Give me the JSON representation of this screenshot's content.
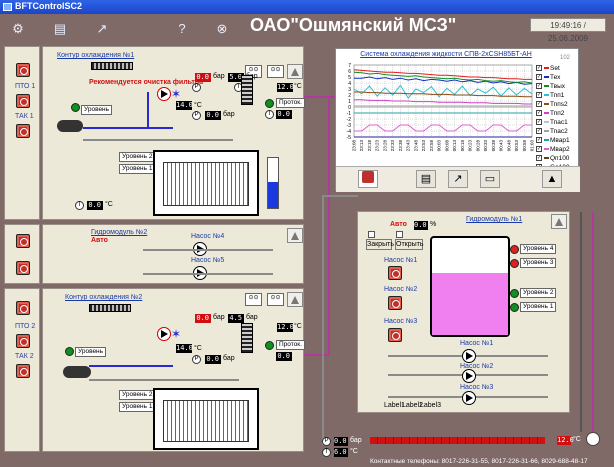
{
  "window": {
    "title": "BFTControlSC2"
  },
  "header": {
    "company": "ОАО\"Ошмянский МСЗ\"",
    "datetime": "19:49:16 / 25.06.2009"
  },
  "toolbar": {
    "icons": [
      "tool-icon",
      "panel-icon",
      "chart-icon",
      "help-icon",
      "close-icon"
    ]
  },
  "sidebar": {
    "pto1": "ПТО 1",
    "tak1": "ТАК 1",
    "pto2": "ПТО 2",
    "tak2": "ТАК 2"
  },
  "contour1": {
    "title": "Контур охлаждения №1",
    "warning": "Рекомендуется очистка фильтра",
    "p1": "0.0",
    "p2": "5.0",
    "p3": "12.0",
    "p4": "14.0",
    "p5": "0.0",
    "t1": "12.0",
    "t2": "0.0",
    "t3": "0.0",
    "unit_bar": "бар",
    "unit_c": "°C",
    "level": "Уровень",
    "level2": "Уровень 2",
    "level1": "Уровень 1",
    "flow": "Проток."
  },
  "module2": {
    "title": "Гидромодуль №2",
    "mode": "Авто",
    "pump4": "Насос №4",
    "pump5": "Насос №5"
  },
  "contour2": {
    "title": "Контур охлаждения №2",
    "p1": "0.0",
    "p2": "4.5",
    "p3": "12.0",
    "p4": "14.0",
    "p5": "0.0",
    "t1": "12.0",
    "t2": "0.0",
    "level": "Уровень",
    "level2": "Уровень 2",
    "level1": "Уровень 1",
    "flow": "Проток."
  },
  "module1": {
    "title": "Гидромодуль №1",
    "mode": "Авто",
    "valve_pct": "0.0",
    "pct": "%",
    "close": "Закрыть",
    "open": "Открыть",
    "nasos1": "Насос №1",
    "nasos2": "Насос №2",
    "nasos3": "Насос №3",
    "level4": "Уровень 4",
    "level3": "Уровень 3",
    "level2": "Уровень 2",
    "level1": "Уровень 1",
    "pump1": "Насос №1",
    "pump2": "Насос №2",
    "pump3": "Насос №3",
    "label1": "Label1",
    "label2": "Label2",
    "label3": "Label3"
  },
  "bottom": {
    "p": "0.0",
    "t": "6.0",
    "unit_bar": "бар",
    "unit_c": "°C",
    "t_right": "12.0",
    "contacts": "Контактные телефоны: 8017-226-31-55, 8017-226-31-66, 8029-688-48-17"
  },
  "chart_data": {
    "type": "line",
    "title": "Система охлаждения жидкости СПВ-2хСSH85БТ-АН",
    "corner_label": "102",
    "ylim": [
      -5,
      7
    ],
    "yticks": [
      "7",
      "6",
      "5",
      "4",
      "3",
      "2",
      "1",
      "0",
      "-1",
      "-2",
      "-3",
      "-4",
      "-5"
    ],
    "xticks": [
      "23:08",
      "23:13",
      "23:18",
      "23:23",
      "23:28",
      "23:33",
      "23:38",
      "23:43",
      "23:48",
      "23:53",
      "23:58",
      "00:03",
      "00:08",
      "00:13",
      "00:18",
      "00:23",
      "00:28",
      "00:33",
      "00:38",
      "00:43",
      "00:48",
      "00:53",
      "00:58",
      "01:03"
    ],
    "grid": true,
    "series": [
      {
        "name": "Set",
        "color": "#e02020",
        "values": [
          6.2,
          6.1,
          6.0,
          5.9,
          5.8,
          5.8,
          5.7,
          5.6,
          5.6,
          5.5,
          5.4,
          5.3,
          5.3,
          5.2,
          5.1,
          5.0,
          5.0,
          4.9,
          4.9,
          4.8,
          4.7,
          4.7,
          4.6,
          4.6
        ]
      },
      {
        "name": "Тех",
        "color": "#1030c0",
        "values": [
          4.8,
          4.8,
          5.0,
          4.7,
          4.9,
          4.6,
          4.8,
          4.5,
          4.7,
          4.4,
          4.6,
          4.5,
          4.3,
          4.5,
          4.2,
          4.4,
          4.1,
          4.3,
          4.0,
          4.2,
          3.9,
          4.1,
          3.8,
          3.9
        ]
      },
      {
        "name": "Твых",
        "color": "#109020",
        "values": [
          5.8,
          5.7,
          5.5,
          5.6,
          5.4,
          5.3,
          5.2,
          5.1,
          5.2,
          5.0,
          4.9,
          4.8,
          4.7,
          4.8,
          4.6,
          4.5,
          4.6,
          4.4,
          4.3,
          4.4,
          4.2,
          4.1,
          4.2,
          4.0
        ]
      },
      {
        "name": "Тпп1",
        "color": "#30c0d0",
        "values": [
          3.0,
          2.2,
          3.5,
          1.8,
          3.2,
          2.0,
          3.6,
          1.5,
          3.0,
          2.4,
          3.4,
          1.7,
          3.1,
          2.1,
          3.5,
          1.9,
          3.0,
          2.3,
          3.3,
          1.8,
          3.2,
          2.0,
          3.1,
          2.2
        ]
      },
      {
        "name": "Тппs2",
        "color": "#8a4a10",
        "values": [
          2.5,
          2.5,
          2.4,
          2.4,
          2.3,
          2.3,
          2.3,
          2.2,
          2.2,
          2.2,
          2.1,
          2.1,
          2.1,
          2.0,
          2.0,
          2.0,
          1.9,
          1.9,
          1.9,
          1.8,
          1.8,
          1.8,
          1.7,
          1.7
        ]
      },
      {
        "name": "Тпп2",
        "color": "#d040c0",
        "values": [
          1.2,
          1.2,
          1.1,
          1.1,
          1.1,
          1.0,
          1.0,
          1.0,
          0.9,
          0.9,
          0.9,
          0.8,
          0.8,
          0.8,
          0.8,
          0.7,
          0.7,
          0.7,
          0.6,
          0.6,
          0.6,
          0.6,
          0.5,
          0.5
        ]
      },
      {
        "name": "Тпас1",
        "color": "#c0c0c0",
        "values": [
          0.2,
          0.2,
          0.2,
          0.2,
          0.2,
          0.2,
          0.2,
          0.2,
          0.2,
          0.2,
          0.2,
          0.2,
          0.2,
          0.2,
          0.2,
          0.2,
          0.2,
          0.2,
          0.2,
          0.2,
          0.2,
          0.2,
          0.2,
          0.2
        ]
      },
      {
        "name": "Тпас2",
        "color": "#a0a0a0",
        "values": [
          0.0,
          0.0,
          0.0,
          0.0,
          0.0,
          0.0,
          0.0,
          0.0,
          0.0,
          0.0,
          0.0,
          0.0,
          0.0,
          0.0,
          0.0,
          0.0,
          0.0,
          0.0,
          0.0,
          0.0,
          0.0,
          0.0,
          0.0,
          0.0
        ]
      },
      {
        "name": "Мвар1",
        "color": "#20a0a0",
        "values": [
          -1.0,
          -1.0,
          -1.0,
          -1.0,
          -1.0,
          -1.0,
          -1.0,
          -1.0,
          -1.0,
          -1.0,
          -1.0,
          -1.0,
          -1.0,
          -1.0,
          -1.0,
          -1.0,
          -1.0,
          -1.0,
          -1.0,
          -1.0,
          -1.0,
          -1.0,
          -1.0,
          -1.0
        ]
      },
      {
        "name": "Мвар2",
        "color": "#e060d0",
        "values": [
          -4.0,
          -4.0,
          -3.0,
          -3.0,
          -4.0,
          -4.0,
          -3.0,
          -3.0,
          -4.0,
          -4.0,
          -3.0,
          -3.0,
          -4.0,
          -4.0,
          -3.0,
          -3.0,
          -4.0,
          -4.0,
          -3.0,
          -3.0,
          -4.0,
          -4.0,
          -3.0,
          -3.0
        ]
      },
      {
        "name": "Qп100",
        "color": "#604020",
        "values": [
          -5,
          -5,
          -5,
          -5,
          -5,
          -5,
          -5,
          -5,
          -5,
          -5,
          -5,
          -5,
          -5,
          -5,
          -5,
          -5,
          -5,
          -5,
          -5,
          -5,
          -5,
          -5,
          -5,
          -5
        ]
      },
      {
        "name": "Go100",
        "color": "#2020a0",
        "values": [
          -5,
          -5,
          -5,
          -5,
          -5,
          -5,
          -5,
          -5,
          -5,
          -5,
          -5,
          -5,
          -5,
          -5,
          -5,
          -5,
          -5,
          -5,
          -5,
          -5,
          -5,
          -5,
          -5,
          -5
        ]
      }
    ]
  }
}
